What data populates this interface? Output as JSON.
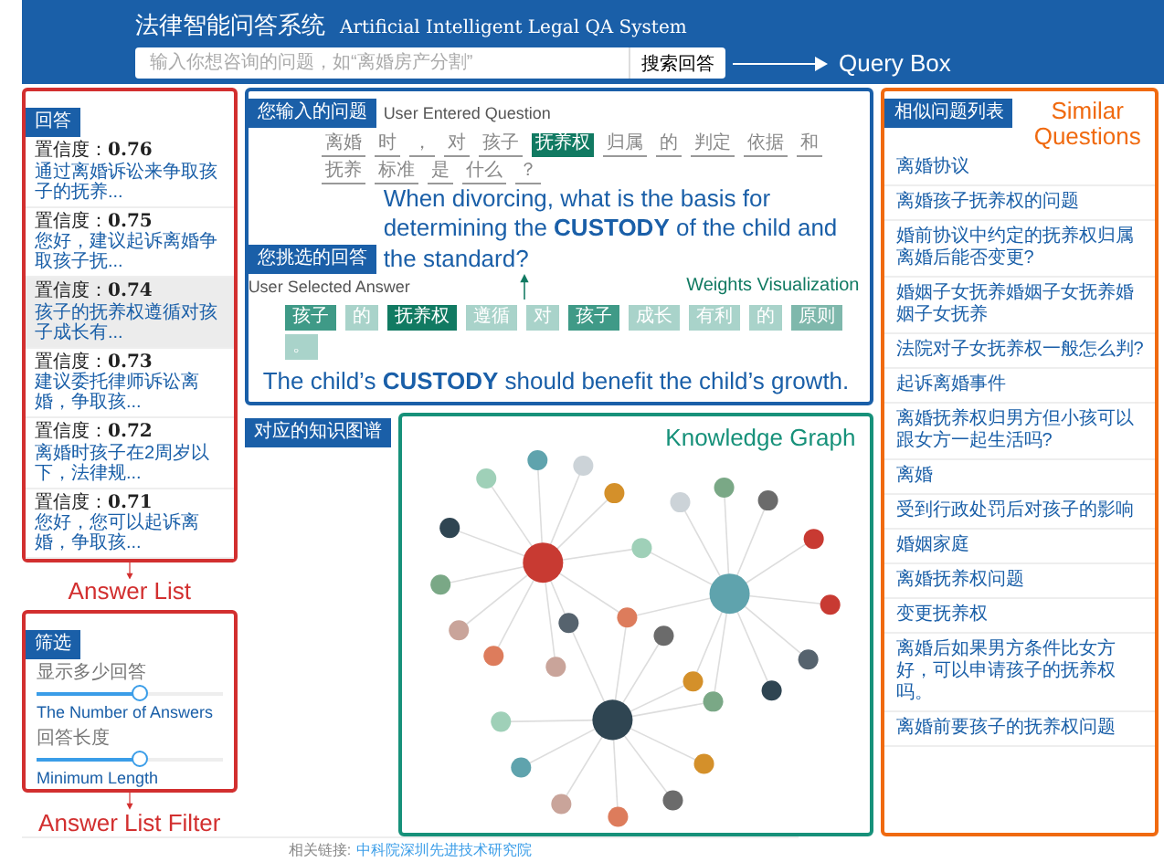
{
  "header": {
    "title": "法律智能问答系统",
    "subtitle": "Artificial Intelligent Legal QA System",
    "search": {
      "placeholder": "输入你想咨询的问题，如“离婚房产分割”"
    },
    "search_button": "搜索回答",
    "annotation": "Query Box"
  },
  "answers": {
    "tab": "回答",
    "items": [
      {
        "score": "置信度：**0.76**",
        "text": "通过离婚诉讼来争取孩子的抚养...",
        "selected": false
      },
      {
        "score": "置信度：**0.75**",
        "text": "您好，建议起诉离婚争取孩子抚...",
        "selected": false
      },
      {
        "score": "置信度：**0.74**",
        "text": "孩子的抚养权遵循对孩子成长有...",
        "selected": true
      },
      {
        "score": "置信度：**0.73**",
        "text": "建议委托律师诉讼离婚，争取孩...",
        "selected": false
      },
      {
        "score": "置信度：**0.72**",
        "text": "离婚时孩子在2周岁以下，法律规...",
        "selected": false
      },
      {
        "score": "置信度：**0.71**",
        "text": "您好，您可以起诉离婚，争取孩...",
        "selected": false
      }
    ],
    "annotation": "Answer List"
  },
  "filter": {
    "tab": "筛选",
    "sliders": [
      {
        "label": "显示多少回答",
        "level": 0.55,
        "annotation": "The Number of Answers"
      },
      {
        "label": "回答长度",
        "level": 0.55,
        "annotation": "Minimum Length"
      }
    ],
    "annotation": "Answer List Filter"
  },
  "question": {
    "tab": "您输入的问题",
    "caption": "User Entered Question",
    "tokens": [
      {
        "text": "离婚",
        "highlighted": false
      },
      {
        "text": "时",
        "highlighted": false
      },
      {
        "text": "，",
        "highlighted": false
      },
      {
        "text": "对",
        "highlighted": false
      },
      {
        "text": "孩子",
        "highlighted": false
      },
      {
        "text": "抚养权",
        "highlighted": true
      },
      {
        "text": "归属",
        "highlighted": false
      },
      {
        "text": "的",
        "highlighted": false
      },
      {
        "text": "判定",
        "highlighted": false
      },
      {
        "text": "依据",
        "highlighted": false
      },
      {
        "text": "和",
        "highlighted": false
      },
      {
        "text": "抚养",
        "highlighted": false
      },
      {
        "text": "标准",
        "highlighted": false
      },
      {
        "text": "是",
        "highlighted": false
      },
      {
        "text": "什么",
        "highlighted": false
      },
      {
        "text": "？",
        "highlighted": false
      }
    ],
    "translation": "When divorcing, what is the basis for determining the **CUSTODY** of the child and the standard?"
  },
  "answer": {
    "tab": "您挑选的回答",
    "caption": "User Selected Answer",
    "weights_annotation": "Weights Visualization",
    "tokens": [
      {
        "text": "孩子",
        "color": "#3f9a87"
      },
      {
        "text": "的",
        "color": "#a9d3ca"
      },
      {
        "text": "抚养权",
        "color": "#117a62"
      },
      {
        "text": "遵循",
        "color": "#a9d3ca"
      },
      {
        "text": "对",
        "color": "#a9d3ca"
      },
      {
        "text": "孩子",
        "color": "#3f9a87"
      },
      {
        "text": "成长",
        "color": "#a9d3ca"
      },
      {
        "text": "有利",
        "color": "#a9d3ca"
      },
      {
        "text": "的",
        "color": "#a9d3ca"
      },
      {
        "text": "原则",
        "color": "#7fb8ac"
      },
      {
        "text": "。",
        "color": "#a9d3ca"
      }
    ],
    "translation": "The child’s **CUSTODY** should benefit the child’s growth."
  },
  "graph": {
    "tab": "对应的知识图谱",
    "annotation": "Knowledge Graph"
  },
  "similar": {
    "tab": "相似问题列表",
    "annotation": "Similar Questions",
    "items": [
      "离婚协议",
      "离婚孩子抚养权的问题",
      "婚前协议中约定的抚养权归属离婚后能否变更?",
      "婚姻子女抚养婚姻子女抚养婚姻子女抚养",
      "法院对子女抚养权一般怎么判?",
      "起诉离婚事件",
      "离婚抚养权归男方但小孩可以跟女方一起生活吗?",
      "离婚",
      "受到行政处罚后对孩子的影响",
      "婚姻家庭",
      "离婚抚养权问题",
      "变更抚养权",
      "离婚后如果男方条件比女方好，可以申请孩子的抚养权吗。",
      "离婚前要孩子的抚养权问题"
    ]
  },
  "footer": {
    "label": "相关链接:",
    "link": "中科院深圳先进技术研究院"
  }
}
